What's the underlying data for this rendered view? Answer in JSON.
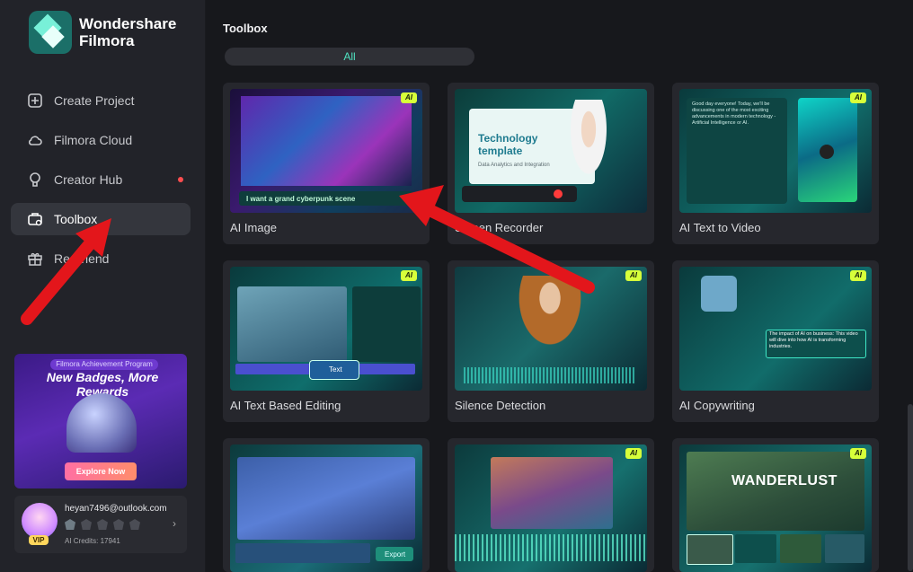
{
  "app": {
    "brand_line1": "Wondershare",
    "brand_line2": "Filmora"
  },
  "sidebar": {
    "items": [
      {
        "label": "Create Project",
        "icon": "plus-square-icon",
        "active": false
      },
      {
        "label": "Filmora Cloud",
        "icon": "cloud-icon",
        "active": false
      },
      {
        "label": "Creator Hub",
        "icon": "bulb-icon",
        "active": false,
        "notification_dot": true
      },
      {
        "label": "Toolbox",
        "icon": "toolbox-icon",
        "active": true
      },
      {
        "label": "Re     Friend",
        "icon": "gift-icon",
        "active": false
      }
    ]
  },
  "promo": {
    "program": "Filmora Achievement Program",
    "headline": "New Badges, More Rewards",
    "cta": "Explore Now"
  },
  "account": {
    "email": "heyan7496@outlook.com",
    "vip": "VIP",
    "credits": "AI Credits: 17941"
  },
  "main": {
    "title": "Toolbox",
    "filter_all": "All",
    "ai_badge": "AI",
    "cards": [
      {
        "label": "AI Image",
        "ai": true,
        "thumb_text": "I want a grand cyberpunk scene"
      },
      {
        "label": "Screen Recorder",
        "ai": false,
        "thumb_text": "Technology template",
        "thumb_sub": "Data Analytics and Integration"
      },
      {
        "label": "AI Text to Video",
        "ai": true,
        "thumb_text": "Good day everyone! Today, we'll be discussing one of the most exciting advancements in modern technology - Artificial Intelligence or AI."
      },
      {
        "label": "AI Text Based Editing",
        "ai": true,
        "thumb_text": "Text"
      },
      {
        "label": "Silence Detection",
        "ai": true
      },
      {
        "label": "AI Copywriting",
        "ai": true,
        "thumb_text": "The impact of AI on business: This video will dive into how AI is transforming industries."
      },
      {
        "label": "",
        "ai": false,
        "thumb_text": "Export"
      },
      {
        "label": "",
        "ai": true
      },
      {
        "label": "",
        "ai": true,
        "thumb_text": "WANDERLUST"
      }
    ]
  },
  "colors": {
    "accent": "#4fe3c1",
    "ai_badge": "#d7ff3a",
    "arrow": "#e3161b"
  }
}
